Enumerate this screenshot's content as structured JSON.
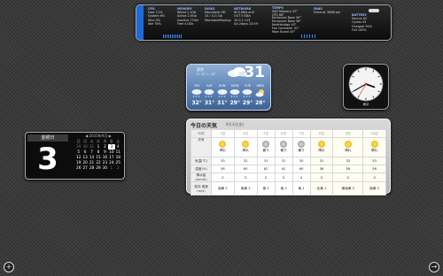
{
  "istat": {
    "col1": {
      "header": "CPU",
      "rows": [
        "User 11%",
        "System 6%",
        "Nice 0%",
        "Idle 76%"
      ]
    },
    "col2": {
      "header": "MEMORY",
      "rows": [
        "Wired 1.1Gb",
        "Active 2.0Gb",
        "Inactive 710m",
        "Free 4.0Gb"
      ]
    },
    "col3": {
      "header": "DISKS",
      "rows": [
        "Macintosh HD",
        "24 / 111 Gb",
        "",
        "MacintoshBackup"
      ]
    },
    "col4": {
      "header": "NETWORK",
      "rows": [
        "IN 0 KB/s  en0",
        "OUT 0 KB/s",
        "10.0.1.113",
        "Up 2days 23:59"
      ]
    },
    "col5": {
      "header": "TEMPS",
      "rows": [
        "SSD Memory 47°",
        "CPU 66°",
        "Enclosure Base 39°",
        "Enclosure Base 36°",
        "Northbridge 45°",
        "Fan Controller 41°",
        "Main Board 45°"
      ]
    },
    "col6": {
      "header": "FANS",
      "rows": [
        "Exhaust 3658rpm"
      ]
    },
    "col7": {
      "header": "BATTERY",
      "rows": [
        "Source AC",
        "Cycles 53",
        "Charged 94%",
        "Full 100%"
      ]
    }
  },
  "weather": {
    "city": "東京",
    "highlow": "H: 32° L: 26°",
    "temp": "31",
    "days": [
      {
        "name": "FRI",
        "temp": "32°",
        "icon": "rain-icon"
      },
      {
        "name": "SAT",
        "temp": "31°",
        "icon": "rain-icon"
      },
      {
        "name": "SUN",
        "temp": "31°",
        "icon": "rain-icon"
      },
      {
        "name": "MON",
        "temp": "29°",
        "icon": "rain-icon"
      },
      {
        "name": "TUE",
        "temp": "29°",
        "icon": "rain-icon"
      },
      {
        "name": "WED",
        "temp": "28°",
        "icon": "sun-cloud-icon"
      }
    ]
  },
  "clock": {
    "city": "東京",
    "hour": 3,
    "minute": 40,
    "second": 35
  },
  "calendar": {
    "weekday": "金曜日",
    "day": "3",
    "month_title": "2010年9月",
    "weekdays": [
      "日",
      "月",
      "火",
      "水",
      "木",
      "金",
      "土"
    ],
    "cells": [
      "29",
      "30",
      "31",
      "1",
      "2",
      "3",
      "4",
      "5",
      "6",
      "7",
      "8",
      "9",
      "10",
      "11",
      "12",
      "13",
      "14",
      "15",
      "16",
      "17",
      "18",
      "19",
      "20",
      "21",
      "22",
      "23",
      "24",
      "25",
      "26",
      "27",
      "28",
      "29",
      "30",
      "1",
      "2"
    ],
    "today_index": 5
  },
  "forecast": {
    "title": "今日の天気",
    "subtitle": "9月3日(金)",
    "header_label": "時間",
    "dates": [
      "3日",
      "4日",
      "5日",
      "6日",
      "7日",
      "8日",
      "9日",
      "10日"
    ],
    "rows": {
      "weather": {
        "label": "天気",
        "values": [
          "晴れ",
          "晴れ",
          "曇り",
          "曇り",
          "曇り",
          "晴れ",
          "晴れ",
          "晴れ"
        ]
      },
      "temp": {
        "label": "気温(℃)",
        "values": [
          "33",
          "32",
          "31",
          "31",
          "30",
          "31",
          "33",
          "33"
        ]
      },
      "humid": {
        "label": "湿度(%)",
        "values": [
          "58",
          "60",
          "62",
          "62",
          "60",
          "58",
          "56",
          "56"
        ]
      },
      "rain": {
        "label": "降水量(mm/h)",
        "values": [
          "0",
          "0",
          "0",
          "0",
          "0",
          "0",
          "0",
          "0"
        ]
      },
      "wind": {
        "label": "風向 風速(m/s)",
        "values": [
          "南東 2",
          "南東 2",
          "南 2",
          "南 2",
          "南 1",
          "北東 1",
          "東南東 2",
          "南東 2"
        ]
      }
    }
  },
  "corner": {
    "add_label": "+",
    "next_label": "→"
  }
}
